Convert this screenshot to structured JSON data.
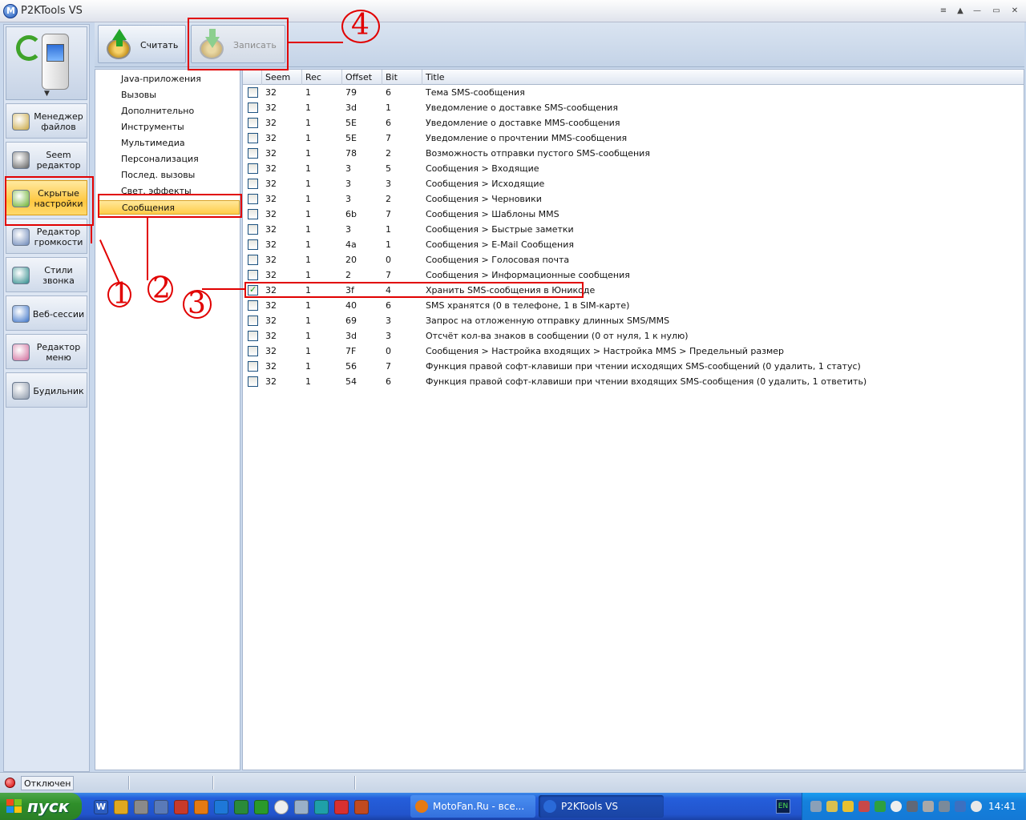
{
  "window": {
    "title": "P2KTools VS"
  },
  "toolbar": {
    "read_label": "Считать",
    "write_label": "Записать"
  },
  "nav": {
    "items": [
      {
        "label": "Менеджер файлов",
        "icon": "file-manager-icon",
        "active": false
      },
      {
        "label": "Seem редактор",
        "icon": "seem-editor-icon",
        "active": false
      },
      {
        "label": "Скрытые настройки",
        "icon": "hidden-settings-icon",
        "active": true
      },
      {
        "label": "Редактор громкости",
        "icon": "volume-editor-icon",
        "active": false
      },
      {
        "label": "Стили звонка",
        "icon": "ring-styles-icon",
        "active": false
      },
      {
        "label": "Веб-сессии",
        "icon": "web-sessions-icon",
        "active": false
      },
      {
        "label": "Редактор меню",
        "icon": "menu-editor-icon",
        "active": false
      },
      {
        "label": "Будильник",
        "icon": "alarm-clock-icon",
        "active": false
      }
    ]
  },
  "categories": [
    "Java-приложения",
    "Вызовы",
    "Дополнительно",
    "Инструменты",
    "Мультимедиа",
    "Персонализация",
    "Послед. вызовы",
    "Свет. эффекты",
    "Сообщения"
  ],
  "selected_category": "Сообщения",
  "grid": {
    "columns": [
      "Seem",
      "Rec",
      "Offset",
      "Bit",
      "Title"
    ],
    "rows": [
      {
        "checked": false,
        "seem": "32",
        "rec": "1",
        "offset": "79",
        "bit": "6",
        "title": "Тема SMS-сообщения"
      },
      {
        "checked": false,
        "seem": "32",
        "rec": "1",
        "offset": "3d",
        "bit": "1",
        "title": "Уведомление о доставке SMS-сообщения"
      },
      {
        "checked": false,
        "seem": "32",
        "rec": "1",
        "offset": "5E",
        "bit": "6",
        "title": "Уведомление о доставке MMS-сообщения"
      },
      {
        "checked": false,
        "seem": "32",
        "rec": "1",
        "offset": "5E",
        "bit": "7",
        "title": "Уведомление о прочтении MMS-сообщения"
      },
      {
        "checked": false,
        "seem": "32",
        "rec": "1",
        "offset": "78",
        "bit": "2",
        "title": "Возможность отправки пустого SMS-сообщения"
      },
      {
        "checked": false,
        "seem": "32",
        "rec": "1",
        "offset": "3",
        "bit": "5",
        "title": "Сообщения > Входящие"
      },
      {
        "checked": false,
        "seem": "32",
        "rec": "1",
        "offset": "3",
        "bit": "3",
        "title": "Сообщения > Исходящие"
      },
      {
        "checked": false,
        "seem": "32",
        "rec": "1",
        "offset": "3",
        "bit": "2",
        "title": "Сообщения > Черновики"
      },
      {
        "checked": false,
        "seem": "32",
        "rec": "1",
        "offset": "6b",
        "bit": "7",
        "title": "Сообщения > Шаблоны MMS"
      },
      {
        "checked": false,
        "seem": "32",
        "rec": "1",
        "offset": "3",
        "bit": "1",
        "title": "Сообщения > Быстрые заметки"
      },
      {
        "checked": false,
        "seem": "32",
        "rec": "1",
        "offset": "4a",
        "bit": "1",
        "title": "Сообщения > E-Mail Сообщения"
      },
      {
        "checked": false,
        "seem": "32",
        "rec": "1",
        "offset": "20",
        "bit": "0",
        "title": "Сообщения > Голосовая почта"
      },
      {
        "checked": false,
        "seem": "32",
        "rec": "1",
        "offset": "2",
        "bit": "7",
        "title": "Сообщения > Информационные сообщения"
      },
      {
        "checked": true,
        "seem": "32",
        "rec": "1",
        "offset": "3f",
        "bit": "4",
        "title": "Хранить SMS-сообщения в Юникоде"
      },
      {
        "checked": false,
        "seem": "32",
        "rec": "1",
        "offset": "40",
        "bit": "6",
        "title": "SMS хранятся (0 в телефоне, 1 в SIM-карте)"
      },
      {
        "checked": false,
        "seem": "32",
        "rec": "1",
        "offset": "69",
        "bit": "3",
        "title": "Запрос на отложенную отправку длинных SMS/MMS"
      },
      {
        "checked": false,
        "seem": "32",
        "rec": "1",
        "offset": "3d",
        "bit": "3",
        "title": "Отсчёт кол-ва знаков в сообщении (0 от нуля, 1 к нулю)"
      },
      {
        "checked": false,
        "seem": "32",
        "rec": "1",
        "offset": "7F",
        "bit": "0",
        "title": "Сообщения > Настройка входящих > Настройка MMS > Предельный размер"
      },
      {
        "checked": false,
        "seem": "32",
        "rec": "1",
        "offset": "56",
        "bit": "7",
        "title": "Функция правой софт-клавиши при чтении исходящих SMS-сообщений (0 удалить, 1 статус)"
      },
      {
        "checked": false,
        "seem": "32",
        "rec": "1",
        "offset": "54",
        "bit": "6",
        "title": "Функция правой софт-клавиши при чтении входящих SMS-сообщения (0 удалить, 1 ответить)"
      }
    ]
  },
  "status": {
    "connection": "Отключен"
  },
  "taskbar": {
    "start_label": "пуск",
    "tasks": [
      {
        "label": "MotoFan.Ru - все...",
        "active": false
      },
      {
        "label": "P2KTools VS",
        "active": true
      }
    ],
    "lang": "EN",
    "clock": "14:41"
  },
  "annotations": [
    "1",
    "2",
    "3",
    "4"
  ],
  "colors": {
    "accent": "#ffc842",
    "annotation": "#e10000",
    "taskbar": "#245edb"
  }
}
